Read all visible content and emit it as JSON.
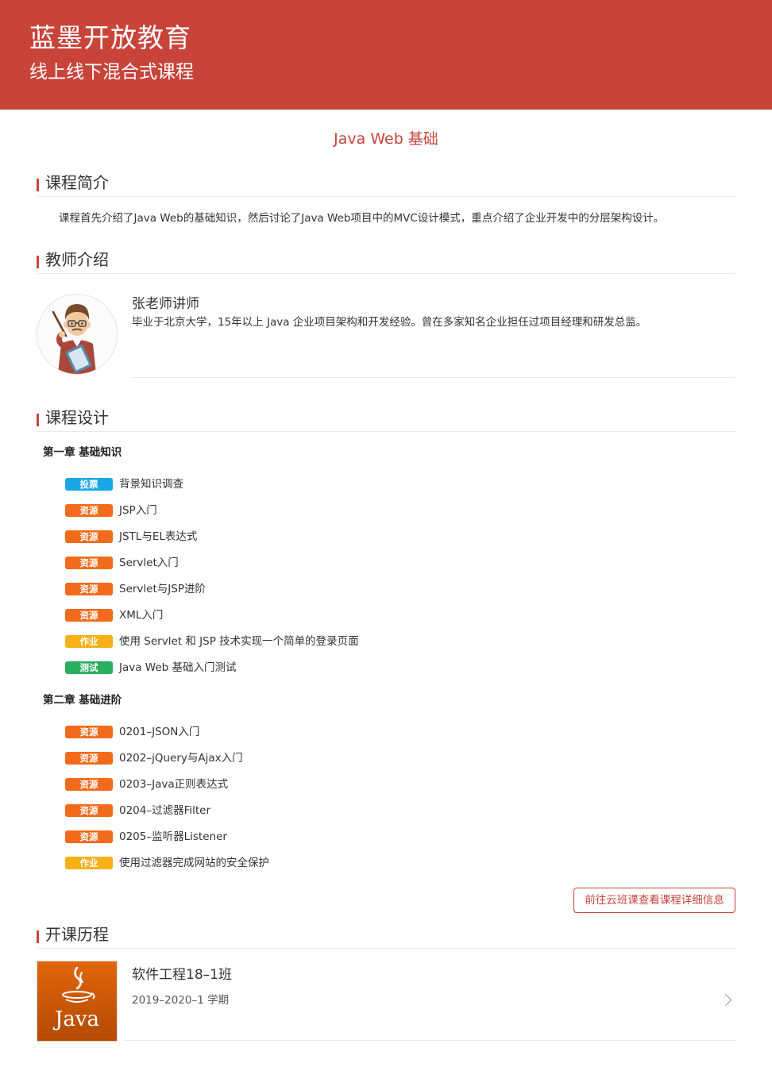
{
  "header": {
    "org_name": "蓝墨开放教育",
    "tagline": "线上线下混合式课程"
  },
  "course": {
    "title": "Java Web 基础"
  },
  "sections": {
    "intro_title": "课程简介",
    "teacher_title": "教师介绍",
    "design_title": "课程设计",
    "history_title": "开课历程"
  },
  "intro": {
    "text": "课程首先介绍了Java Web的基础知识，然后讨论了Java Web项目中的MVC设计模式，重点介绍了企业开发中的分层架构设计。"
  },
  "teacher": {
    "name": "张老师讲师",
    "desc": "毕业于北京大学，15年以上 Java 企业项目架构和开发经验。曾在多家知名企业担任过项目经理和研发总监。"
  },
  "badge_colors": {
    "投票": "#1aa7e6",
    "资源": "#f26a1b",
    "作业": "#f7b015",
    "测试": "#2cae5f"
  },
  "chapters": [
    {
      "title": "第一章 基础知识",
      "items": [
        {
          "type": "投票",
          "title": "背景知识调查"
        },
        {
          "type": "资源",
          "title": "JSP入门"
        },
        {
          "type": "资源",
          "title": "JSTL与EL表达式"
        },
        {
          "type": "资源",
          "title": "Servlet入门"
        },
        {
          "type": "资源",
          "title": "Servlet与JSP进阶"
        },
        {
          "type": "资源",
          "title": "XML入门"
        },
        {
          "type": "作业",
          "title": "使用 Servlet 和 JSP 技术实现一个简单的登录页面"
        },
        {
          "type": "测试",
          "title": "Java Web 基础入门测试"
        }
      ]
    },
    {
      "title": "第二章 基础进阶",
      "items": [
        {
          "type": "资源",
          "title": "0201–JSON入门"
        },
        {
          "type": "资源",
          "title": "0202–jQuery与Ajax入门"
        },
        {
          "type": "资源",
          "title": "0203–Java正则表达式"
        },
        {
          "type": "资源",
          "title": "0204–过滤器Filter"
        },
        {
          "type": "资源",
          "title": "0205–监听器Listener"
        },
        {
          "type": "作业",
          "title": "使用过滤器完成网站的安全保护"
        }
      ]
    }
  ],
  "more_button": {
    "label": "前往云班课查看课程详细信息"
  },
  "class_history": [
    {
      "name": "软件工程18–1班",
      "term": "2019–2020–1 学期",
      "thumb_text": "Java",
      "thumb_icon": "java-logo-icon"
    }
  ]
}
